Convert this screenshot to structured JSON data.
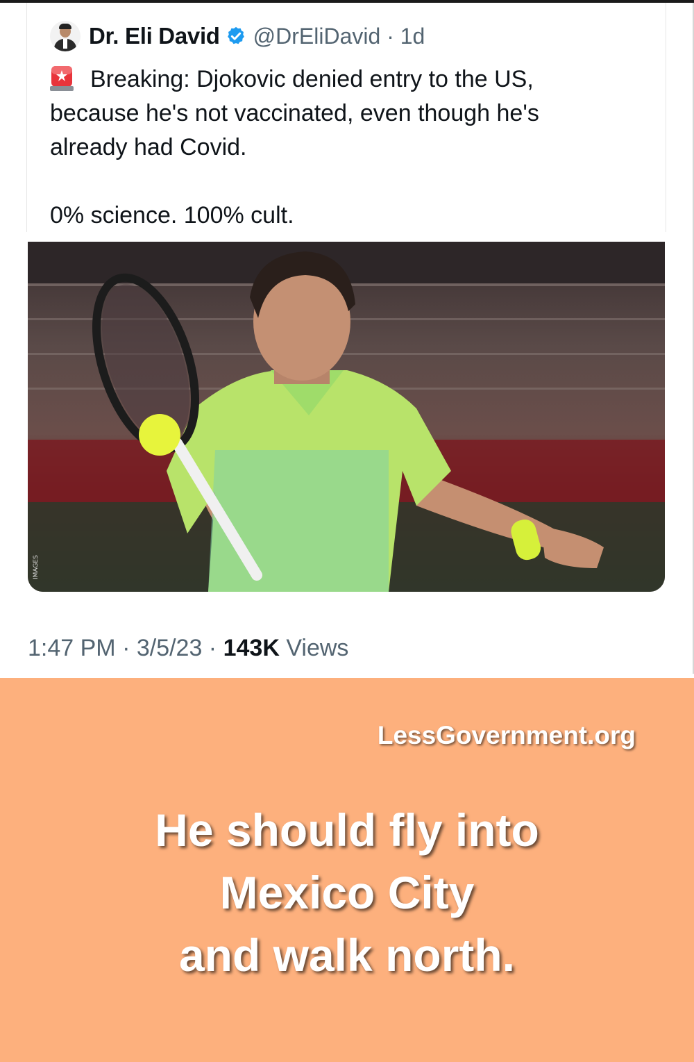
{
  "tweet": {
    "author_name": "Dr. Eli David",
    "handle": "@DrEliDavid",
    "age": "1d",
    "handle_line": "@DrEliDavid · 1d",
    "text_line1": "Breaking: Djokovic denied entry to the US,",
    "text_line2": "because he's not vaccinated, even though he's",
    "text_line3": "already had Covid.",
    "text_line4": "0% science. 100% cult.",
    "time": "1:47 PM · 3/5/23 · ",
    "views_count": "143K",
    "views_label": " Views",
    "image_watermark": "IMAGES"
  },
  "promo": {
    "site": "LessGovernment.org",
    "caption_line1": "He should fly into",
    "caption_line2": "Mexico City",
    "caption_line3": "and walk north."
  },
  "colors": {
    "promo_background": "#fdb07d",
    "verified_blue": "#1d9bf0",
    "secondary_text": "#536471"
  },
  "icons": [
    "avatar",
    "verified-badge-icon",
    "siren-emoji-icon"
  ]
}
